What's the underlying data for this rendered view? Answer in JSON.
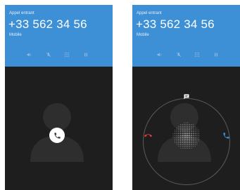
{
  "screens": [
    {
      "header": {
        "label": "Appel entrant",
        "number": "+33 562 34 56",
        "type": "Mobile"
      },
      "icons": [
        "speaker-icon",
        "mute-icon",
        "dialpad-icon",
        "pause-icon"
      ],
      "state": "incoming-idle"
    },
    {
      "header": {
        "label": "Appel entrant",
        "number": "+33 562 34 56",
        "type": "Mobile"
      },
      "icons": [
        "speaker-icon",
        "mute-icon",
        "dialpad-icon",
        "pause-icon"
      ],
      "state": "incoming-swipe-options",
      "actions": [
        "decline-call",
        "reply-message",
        "accept-call"
      ]
    }
  ],
  "colors": {
    "header": "#3d8fd6",
    "background": "#1e1e1e",
    "decline": "#e03a3a",
    "accept": "#3d8fd6"
  }
}
